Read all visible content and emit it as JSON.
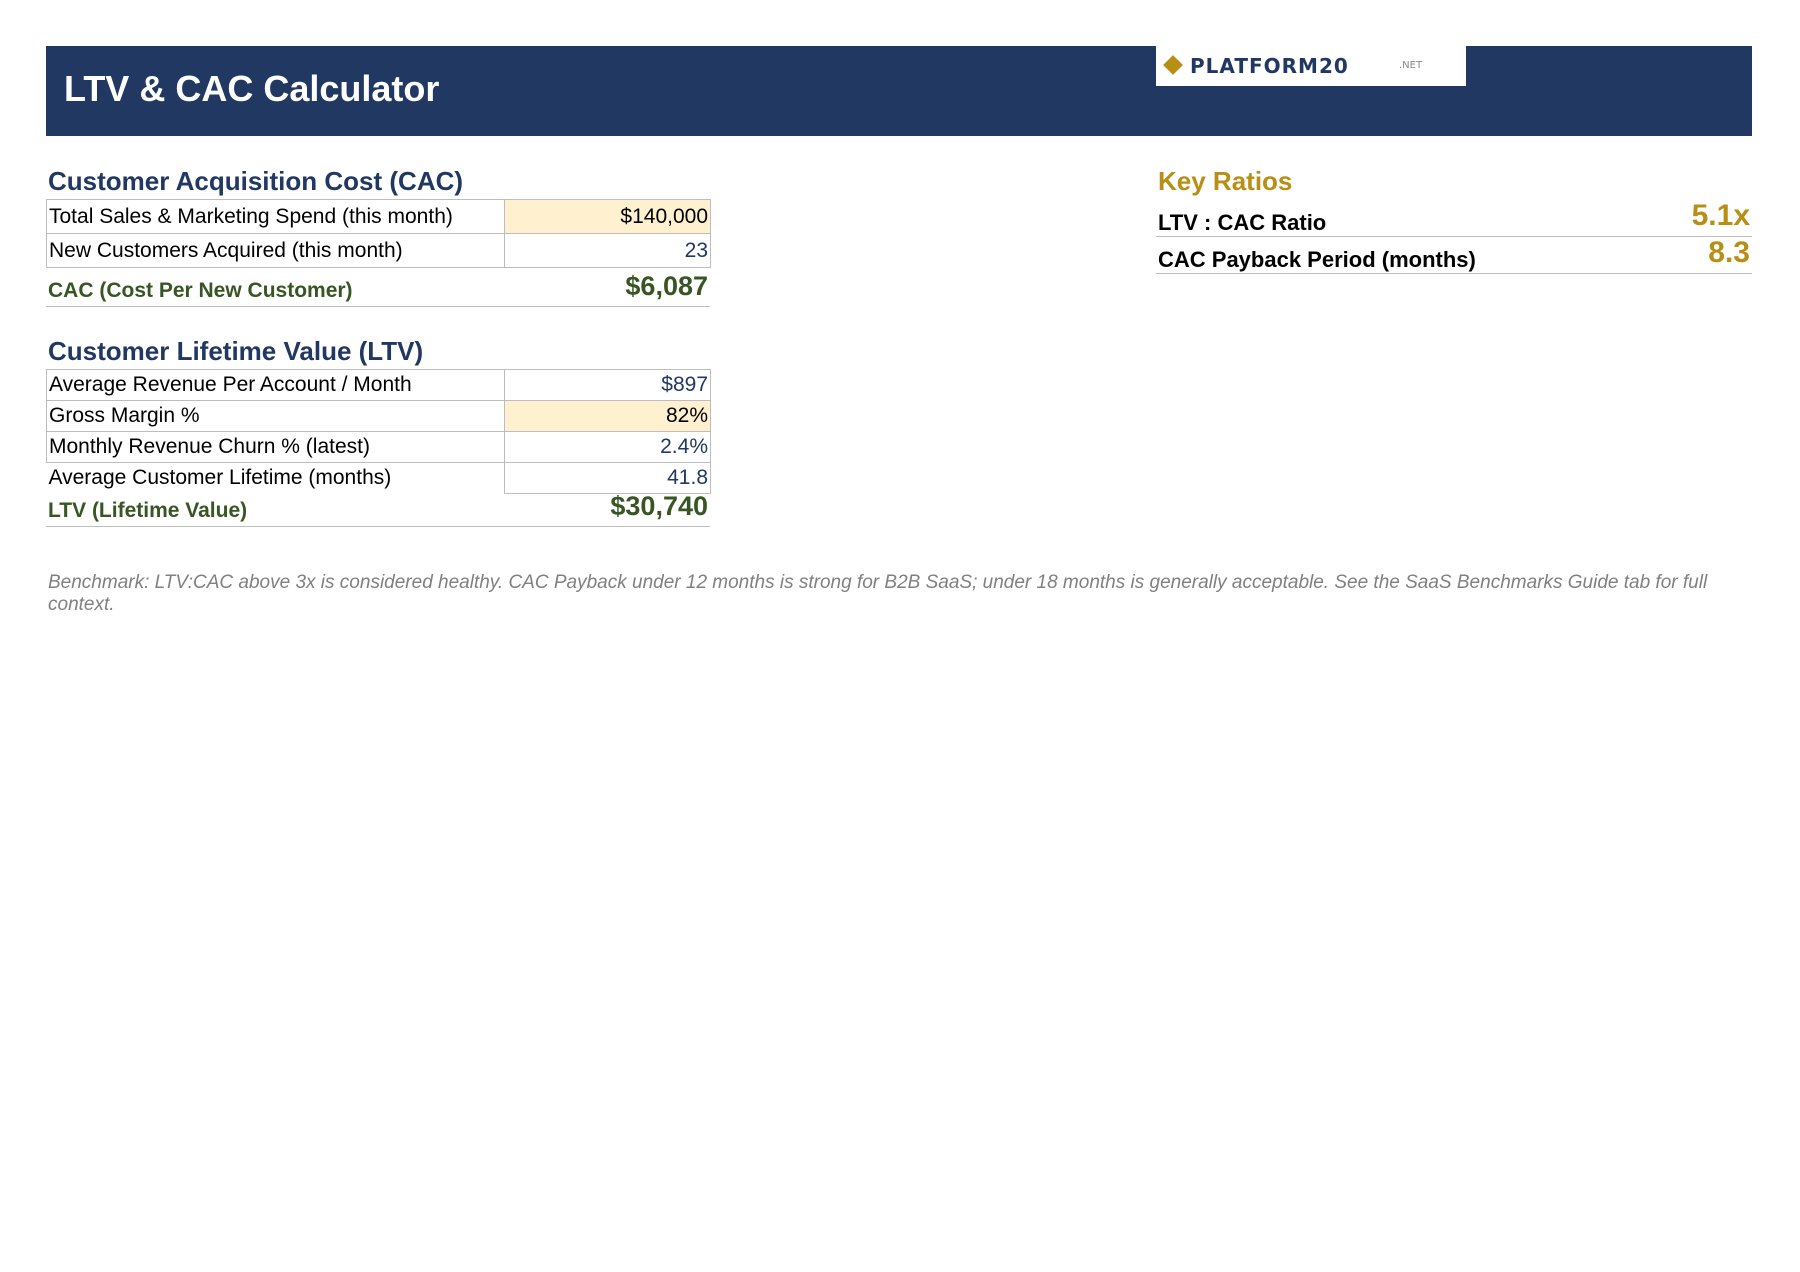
{
  "header": {
    "title": "LTV & CAC Calculator",
    "logo_text": "PLATFORM20",
    "logo_suffix": ".NET"
  },
  "cac": {
    "heading": "Customer Acquisition Cost (CAC)",
    "rows": [
      {
        "label": "Total Sales & Marketing Spend (this month)",
        "value": "$140,000"
      },
      {
        "label": "New Customers Acquired (this month)",
        "value": "23"
      }
    ],
    "result_label": "CAC (Cost Per New Customer)",
    "result_value": "$6,087"
  },
  "ltv": {
    "heading": "Customer Lifetime Value (LTV)",
    "rows": [
      {
        "label": "Average Revenue Per Account / Month",
        "value": "$897"
      },
      {
        "label": "Gross Margin %",
        "value": "82%"
      },
      {
        "label": "Monthly Revenue Churn % (latest)",
        "value": "2.4%"
      },
      {
        "label": "Average Customer Lifetime (months)",
        "value": "41.8"
      }
    ],
    "result_label": "LTV (Lifetime Value)",
    "result_value": "$30,740"
  },
  "ratios": {
    "heading": "Key Ratios",
    "items": [
      {
        "label": "LTV : CAC Ratio",
        "value": "5.1x"
      },
      {
        "label": "CAC Payback Period (months)",
        "value": "8.3"
      }
    ]
  },
  "note": "Benchmark: LTV:CAC above 3x is considered healthy. CAC Payback under 12 months is strong for B2B SaaS; under 18 months is generally acceptable. See the SaaS Benchmarks Guide tab for full context.",
  "colors": {
    "header_bg": "#213862",
    "accent_gold": "#b88f14",
    "result_green": "#375623",
    "input_fill": "#fff1cf"
  }
}
